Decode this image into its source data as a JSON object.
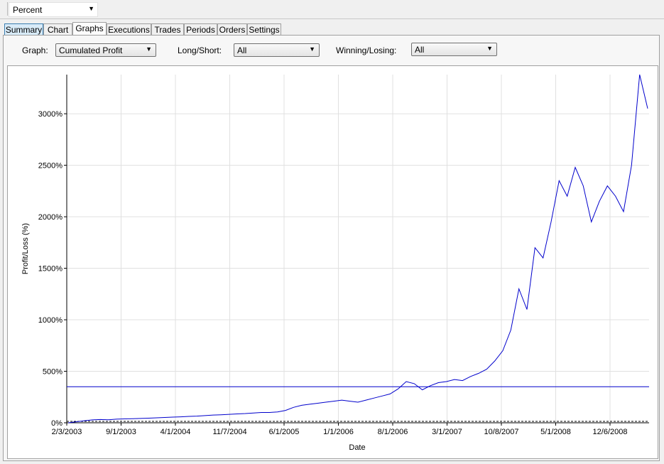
{
  "toolbar": {
    "mode_value": "Percent"
  },
  "tabs": [
    "Summary",
    "Chart",
    "Graphs",
    "Executions",
    "Trades",
    "Periods",
    "Orders",
    "Settings"
  ],
  "filters": {
    "graph_label": "Graph:",
    "graph_value": "Cumulated Profit",
    "longshort_label": "Long/Short:",
    "longshort_value": "All",
    "winlose_label": "Winning/Losing:",
    "winlose_value": "All"
  },
  "colors": {
    "series": "#0000cc",
    "grid": "#e0e0e0"
  },
  "chart_data": {
    "type": "line",
    "title": "",
    "xlabel": "Date",
    "ylabel": "Profit/Loss (%)",
    "x_ticks": [
      "2/3/2003",
      "9/1/2003",
      "4/1/2004",
      "11/7/2004",
      "6/1/2005",
      "1/1/2006",
      "8/1/2006",
      "3/1/2007",
      "10/8/2007",
      "5/1/2008",
      "12/6/2008"
    ],
    "y_ticks": [
      "0%",
      "500%",
      "1000%",
      "1500%",
      "2000%",
      "2500%",
      "3000%"
    ],
    "ylim": [
      0,
      3380
    ],
    "grid": true,
    "horizontal_line": 350,
    "series": [
      {
        "values": [
          0,
          10,
          20,
          28,
          32,
          30,
          35,
          38,
          40,
          42,
          45,
          48,
          52,
          55,
          58,
          62,
          65,
          70,
          75,
          78,
          82,
          86,
          90,
          95,
          100,
          100,
          105,
          120,
          150,
          170,
          180,
          190,
          200,
          210,
          220,
          210,
          200,
          220,
          240,
          260,
          280,
          330,
          400,
          380,
          320,
          360,
          390,
          400,
          420,
          410,
          450,
          480,
          520,
          600,
          700,
          900,
          1300,
          1100,
          1700,
          1600,
          1950,
          2350,
          2200,
          2480,
          2300,
          1950,
          2150,
          2300,
          2200,
          2050,
          2500,
          3380,
          3050
        ]
      }
    ]
  }
}
